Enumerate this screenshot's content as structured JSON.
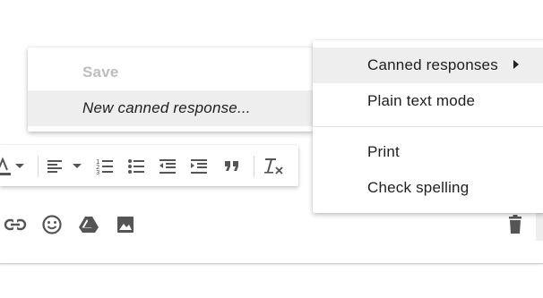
{
  "submenu": {
    "save_label": "Save",
    "new_canned_label": "New canned response..."
  },
  "menu": {
    "canned_label": "Canned responses",
    "plain_text_label": "Plain text mode",
    "print_label": "Print",
    "spell_label": "Check spelling"
  },
  "toolbar_icons": [
    "text-color-icon",
    "align-icon",
    "numbered-list-icon",
    "bulleted-list-icon",
    "indent-less-icon",
    "indent-more-icon",
    "quote-icon",
    "remove-formatting-icon"
  ],
  "action_icons": [
    "insert-link-icon",
    "insert-emoji-icon",
    "insert-drive-icon",
    "insert-photo-icon",
    "discard-draft-icon"
  ],
  "colors": {
    "icon": "#555555",
    "highlight": "#eeeeee",
    "disabled_text": "#bdbdbd"
  }
}
